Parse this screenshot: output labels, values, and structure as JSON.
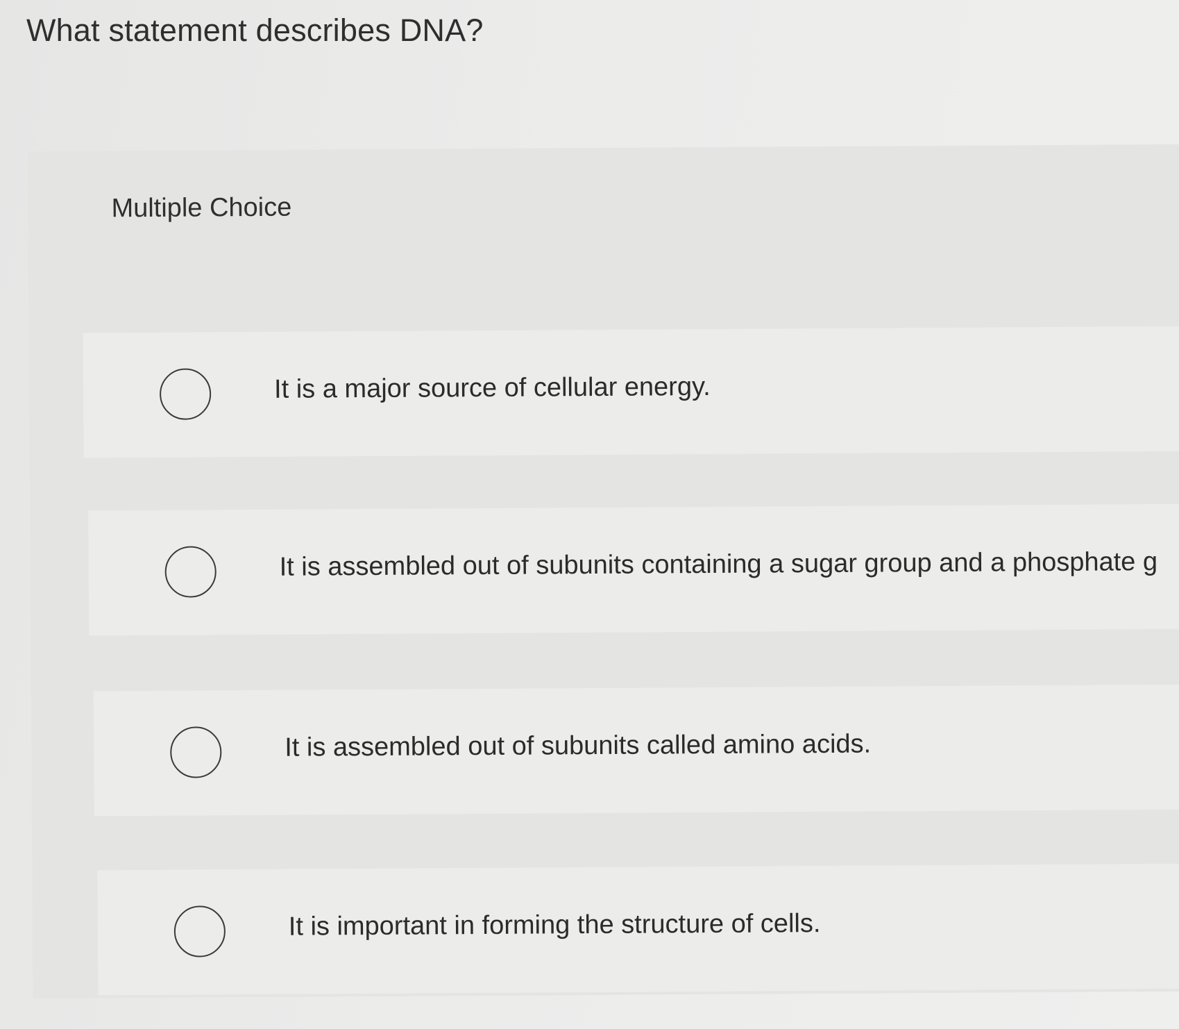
{
  "question": {
    "title": "What statement describes DNA?"
  },
  "panel": {
    "header": "Multiple Choice"
  },
  "options": [
    {
      "label": "It is a major source of cellular energy."
    },
    {
      "label": "It is assembled out of subunits containing a sugar group and a phosphate g"
    },
    {
      "label": "It is assembled out of subunits called amino acids."
    },
    {
      "label": "It is important in forming the structure of cells."
    }
  ]
}
